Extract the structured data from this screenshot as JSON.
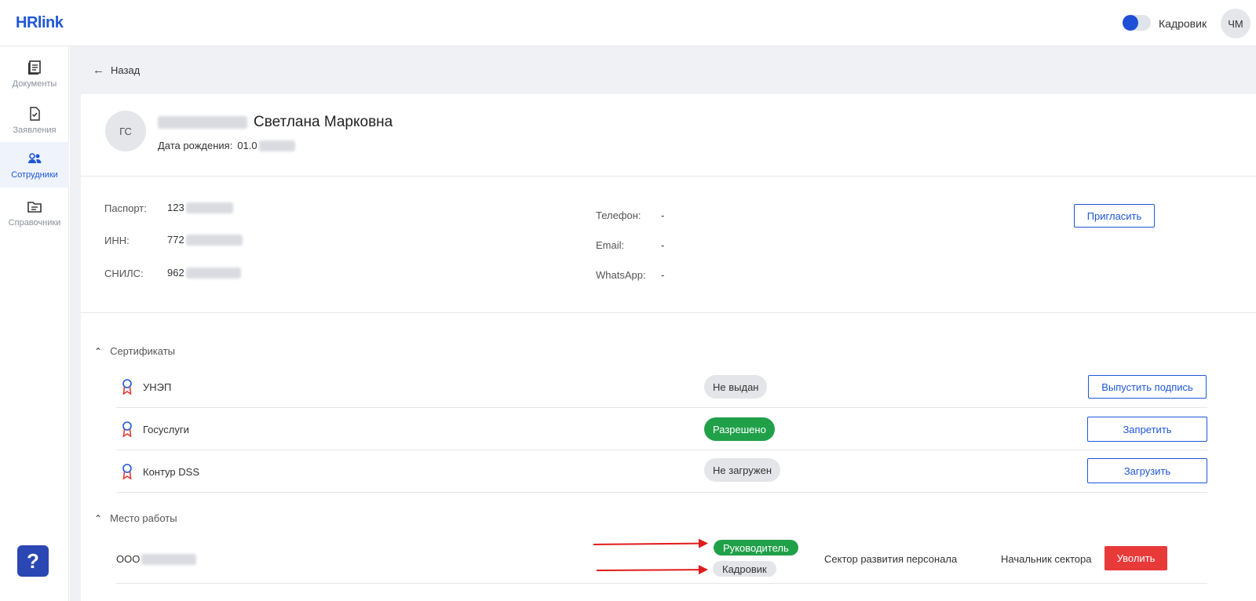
{
  "header": {
    "logo": "HRlink",
    "role_label": "Кадровик",
    "user_initials": "ЧМ",
    "role_toggle_on": true
  },
  "sidebar": {
    "items": [
      {
        "label": "Документы",
        "icon": "documents-icon",
        "active": false
      },
      {
        "label": "Заявления",
        "icon": "applications-icon",
        "active": false
      },
      {
        "label": "Сотрудники",
        "icon": "employees-icon",
        "active": true
      },
      {
        "label": "Справочники",
        "icon": "directories-icon",
        "active": false
      }
    ],
    "help_label": "?"
  },
  "nav": {
    "back_label": "Назад"
  },
  "employee": {
    "initials": "ГС",
    "name_visible": "Светлана Марковна",
    "dob_label": "Дата рождения:",
    "dob_value": "01.0"
  },
  "details": {
    "passport_label": "Паспорт:",
    "passport_value": "123",
    "inn_label": "ИНН:",
    "inn_value": "772",
    "snils_label": "СНИЛС:",
    "snils_value": "962",
    "phone_label": "Телефон:",
    "phone_value": "-",
    "email_label": "Email:",
    "email_value": "-",
    "whatsapp_label": "WhatsApp:",
    "whatsapp_value": "-",
    "invite_button": "Пригласить"
  },
  "certificates": {
    "title": "Сертификаты",
    "rows": [
      {
        "name": "УНЭП",
        "status": "Не выдан",
        "status_color": "#e4e5e8",
        "action": "Выпустить подпись"
      },
      {
        "name": "Госуслуги",
        "status": "Разрешено",
        "status_color": "#21a04a",
        "action": "Запретить"
      },
      {
        "name": "Контур DSS",
        "status": "Не загружен",
        "status_color": "#e4e5e8",
        "action": "Загрузить"
      }
    ]
  },
  "workplace": {
    "title": "Место работы",
    "org_prefix": "ООО",
    "role_manager": "Руководитель",
    "role_hr": "Кадровик",
    "department": "Сектор развития персонала",
    "position": "Начальник сектора",
    "dismiss_button": "Уволить"
  },
  "colors": {
    "accent": "#1f57d6",
    "success": "#21a04a",
    "danger": "#e93a3a",
    "annotation_arrow": "#e01b1b"
  }
}
